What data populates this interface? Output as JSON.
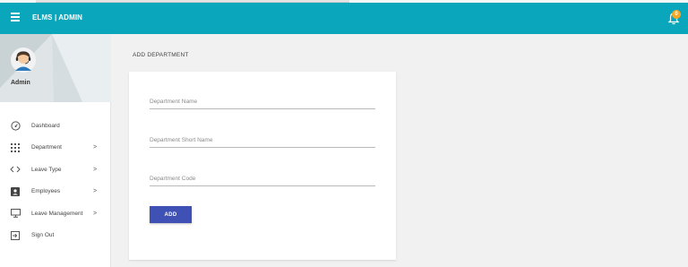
{
  "header": {
    "brand": "ELMS | ADMIN",
    "notification_count": "0",
    "colors": {
      "navbar": "#0aa7bc",
      "badge": "#f5a623"
    }
  },
  "sidebar": {
    "profile_name": "Admin",
    "items": [
      {
        "label": "Dashboard",
        "icon": "dashboard-icon",
        "has_submenu": false
      },
      {
        "label": "Department",
        "icon": "grid-icon",
        "has_submenu": true
      },
      {
        "label": "Leave Type",
        "icon": "code-icon",
        "has_submenu": true
      },
      {
        "label": "Employees",
        "icon": "account-box-icon",
        "has_submenu": true
      },
      {
        "label": "Leave Management",
        "icon": "desktop-icon",
        "has_submenu": true
      },
      {
        "label": "Sign Out",
        "icon": "sign-out-icon",
        "has_submenu": false
      }
    ],
    "chevron": ">"
  },
  "main": {
    "page_title": "ADD DEPARTMENT",
    "form": {
      "department_name": {
        "placeholder": "Department Name",
        "value": ""
      },
      "department_short_name": {
        "placeholder": "Department Short Name",
        "value": ""
      },
      "department_code": {
        "placeholder": "Department Code",
        "value": ""
      },
      "submit_label": "ADD",
      "button_color": "#3f51b5"
    }
  }
}
